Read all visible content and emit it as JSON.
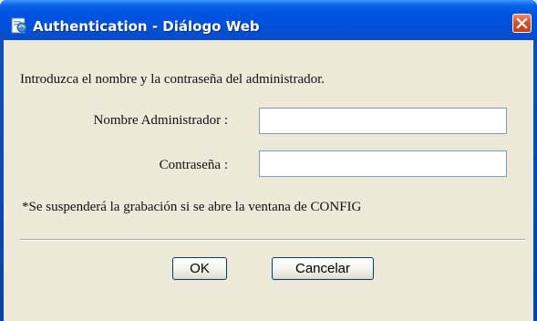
{
  "window": {
    "title": "Authentication - Diálogo Web",
    "accent": "#0054e3",
    "close_color": "#d4552c"
  },
  "icons": {
    "app_icon": "ie-page-icon",
    "close_icon": "close-x-icon"
  },
  "dialog": {
    "message": "Introduzca el nombre y la contraseña del administrador.",
    "admin_label": "Nombre Administrador :",
    "admin_value": "",
    "password_label": "Contraseña :",
    "password_value": "",
    "note": "*Se suspenderá la grabación si se abre la ventana de CONFIG",
    "ok_label": "OK",
    "cancel_label": "Cancelar"
  }
}
